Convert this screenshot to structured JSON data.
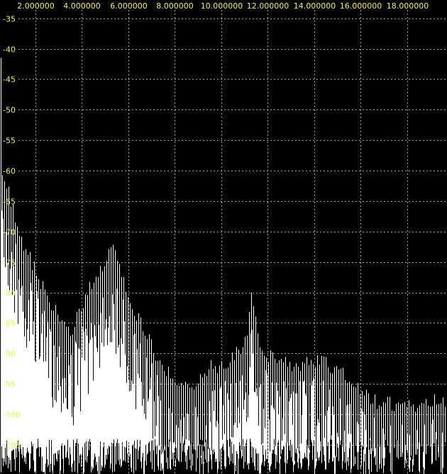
{
  "chart_data": {
    "type": "line",
    "title": "",
    "xlabel": "",
    "ylabel": "",
    "x_ticks": [
      "2.000000",
      "4.000000",
      "6.000000",
      "8.000000",
      "10.000000",
      "12.000000",
      "14.000000",
      "16.000000",
      "18.000000"
    ],
    "y_ticks": [
      "-35",
      "-40",
      "-45",
      "-50",
      "-55",
      "-60",
      "-65",
      "-70",
      "-75",
      "-80",
      "-85",
      "-90",
      "-95",
      "-100",
      "-105"
    ],
    "xlim": [
      0.48,
      19.72
    ],
    "ylim": [
      -109.8,
      -32.0
    ],
    "grid": true,
    "series": [
      {
        "color": "#ffffff",
        "x": [
          0.05,
          0.5,
          0.9,
          1.2,
          1.5,
          2.0,
          2.5,
          3.0,
          3.5,
          4.0,
          4.3,
          4.6,
          4.9,
          5.2,
          5.5,
          5.8,
          6.2,
          6.6,
          7.0,
          7.5,
          8.0,
          8.5,
          9.0,
          9.5,
          10.0,
          10.5,
          11.0,
          11.3,
          11.7,
          12.0,
          12.5,
          13.0,
          13.5,
          14.0,
          14.5,
          15.0,
          15.5,
          16.0,
          16.5,
          17.0,
          17.5,
          18.0,
          18.5,
          19.0,
          19.5,
          19.72
        ],
        "peak": [
          -41.5,
          -58.0,
          -63.0,
          -68.0,
          -71.0,
          -75.0,
          -80.0,
          -82.0,
          -85.5,
          -81.0,
          -78.5,
          -76.0,
          -74.0,
          -71.5,
          -73.0,
          -77.0,
          -81.0,
          -84.5,
          -87.5,
          -91.0,
          -93.5,
          -94.5,
          -93.0,
          -91.0,
          -91.0,
          -89.0,
          -87.5,
          -80.0,
          -88.0,
          -89.0,
          -90.5,
          -90.5,
          -90.5,
          -90.0,
          -90.5,
          -91.5,
          -93.0,
          -95.0,
          -96.5,
          -97.0,
          -97.0,
          -97.5,
          -97.0,
          -96.5,
          -97.0,
          -97.0
        ]
      }
    ]
  }
}
